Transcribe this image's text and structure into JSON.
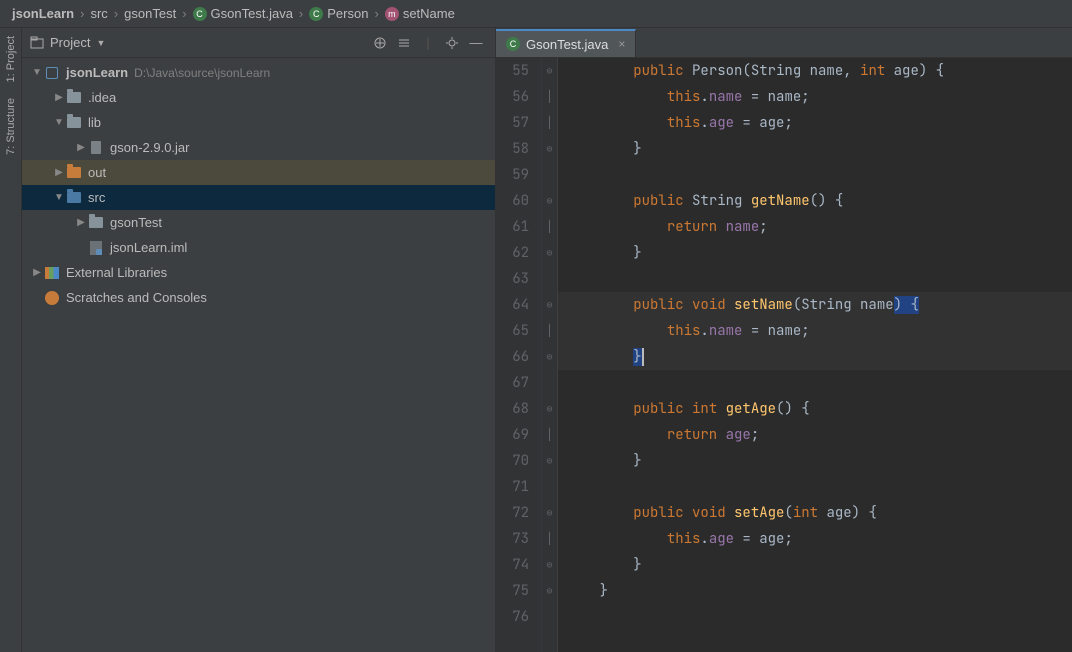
{
  "breadcrumb": {
    "root": "jsonLearn",
    "parts": [
      "src",
      "gsonTest"
    ],
    "file": "GsonTest.java",
    "klass": "Person",
    "method": "setName"
  },
  "panel": {
    "title": "Project"
  },
  "rail": {
    "project": "1: Project",
    "structure": "7: Structure"
  },
  "tree": {
    "root": "jsonLearn",
    "rootPath": "D:\\Java\\source\\jsonLearn",
    "idea": ".idea",
    "lib": "lib",
    "jar": "gson-2.9.0.jar",
    "out": "out",
    "src": "src",
    "pkg": "gsonTest",
    "iml": "jsonLearn.iml",
    "ext": "External Libraries",
    "scratch": "Scratches and Consoles"
  },
  "tab": {
    "name": "GsonTest.java"
  },
  "code": {
    "l55": {
      "kw": "public",
      "cls": "Person",
      "paren": "(String ",
      "p1": "name",
      "c": ", ",
      "int": "int ",
      "p2": "age",
      "end": ") {"
    },
    "l56": {
      "this": "this",
      "dot": ".",
      "fld": "name",
      "eq": " = ",
      "v": "name",
      "sc": ";"
    },
    "l57": {
      "this": "this",
      "dot": ".",
      "fld": "age",
      "eq": " = ",
      "v": "age",
      "sc": ";"
    },
    "l58": "}",
    "l60": {
      "kw": "public ",
      "typ": "String ",
      "fn": "getName",
      "end": "() {"
    },
    "l61": {
      "kw": "return ",
      "fld": "name",
      "sc": ";"
    },
    "l62": "}",
    "l64": {
      "kw": "public ",
      "void": "void ",
      "fn": "setName",
      "paren": "(String ",
      "p": "name",
      "end": ") {"
    },
    "l65": {
      "this": "this",
      "dot": ".",
      "fld": "name",
      "eq": " = ",
      "v": "name",
      "sc": ";"
    },
    "l66": "}",
    "l68": {
      "kw": "public ",
      "int": "int ",
      "fn": "getAge",
      "end": "() {"
    },
    "l69": {
      "kw": "return ",
      "fld": "age",
      "sc": ";"
    },
    "l70": "}",
    "l72": {
      "kw": "public ",
      "void": "void ",
      "fn": "setAge",
      "paren": "(",
      "int": "int ",
      "p": "age",
      "end": ") {"
    },
    "l73": {
      "this": "this",
      "dot": ".",
      "fld": "age",
      "eq": " = ",
      "v": "age",
      "sc": ";"
    },
    "l74": "}",
    "l75": "}"
  },
  "lines": [
    "55",
    "56",
    "57",
    "58",
    "59",
    "60",
    "61",
    "62",
    "63",
    "64",
    "65",
    "66",
    "67",
    "68",
    "69",
    "70",
    "71",
    "72",
    "73",
    "74",
    "75",
    "76"
  ]
}
